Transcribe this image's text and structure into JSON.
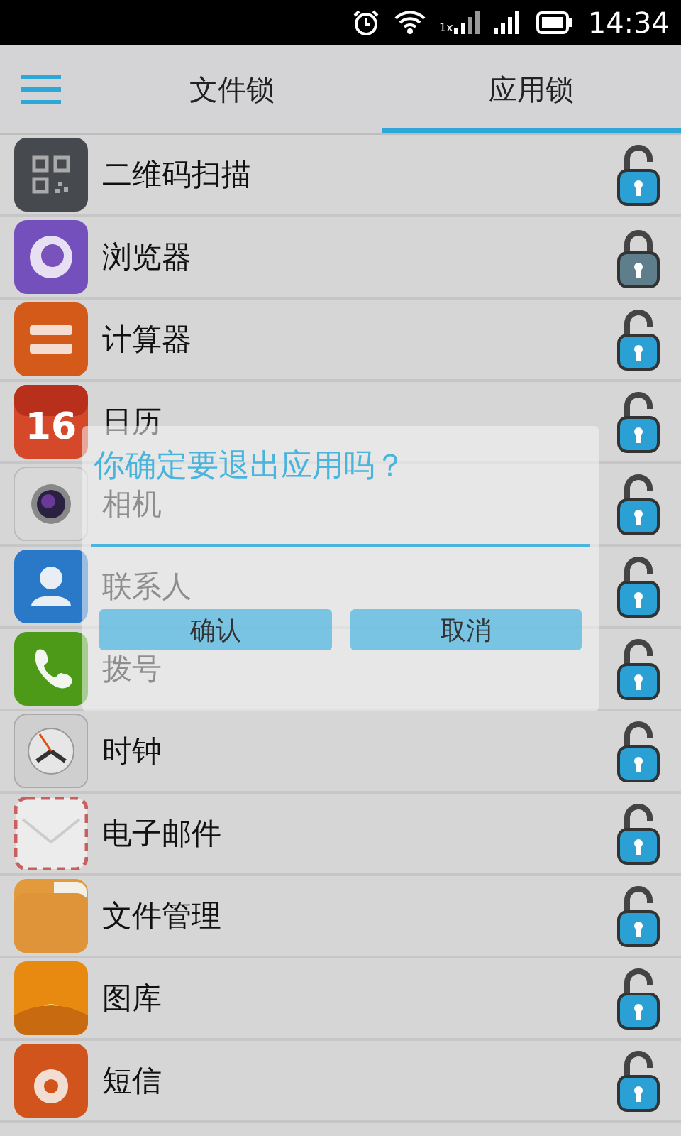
{
  "status_bar": {
    "network_label": "1x",
    "time": "14:34"
  },
  "header": {
    "tabs": [
      {
        "label": "文件锁",
        "selected": false
      },
      {
        "label": "应用锁",
        "selected": true
      }
    ]
  },
  "apps": [
    {
      "name": "二维码扫描",
      "locked": false
    },
    {
      "name": "浏览器",
      "locked": true
    },
    {
      "name": "计算器",
      "locked": false
    },
    {
      "name": "日历",
      "locked": false,
      "icon_label": "16"
    },
    {
      "name": "相机",
      "locked": false
    },
    {
      "name": "联系人",
      "locked": false
    },
    {
      "name": "拨号",
      "locked": false
    },
    {
      "name": "时钟",
      "locked": false
    },
    {
      "name": "电子邮件",
      "locked": false
    },
    {
      "name": "文件管理",
      "locked": false
    },
    {
      "name": "图库",
      "locked": false
    },
    {
      "name": "短信",
      "locked": false
    }
  ],
  "dialog": {
    "title": "你确定要退出应用吗？",
    "buttons": [
      "确认",
      "取消"
    ]
  }
}
